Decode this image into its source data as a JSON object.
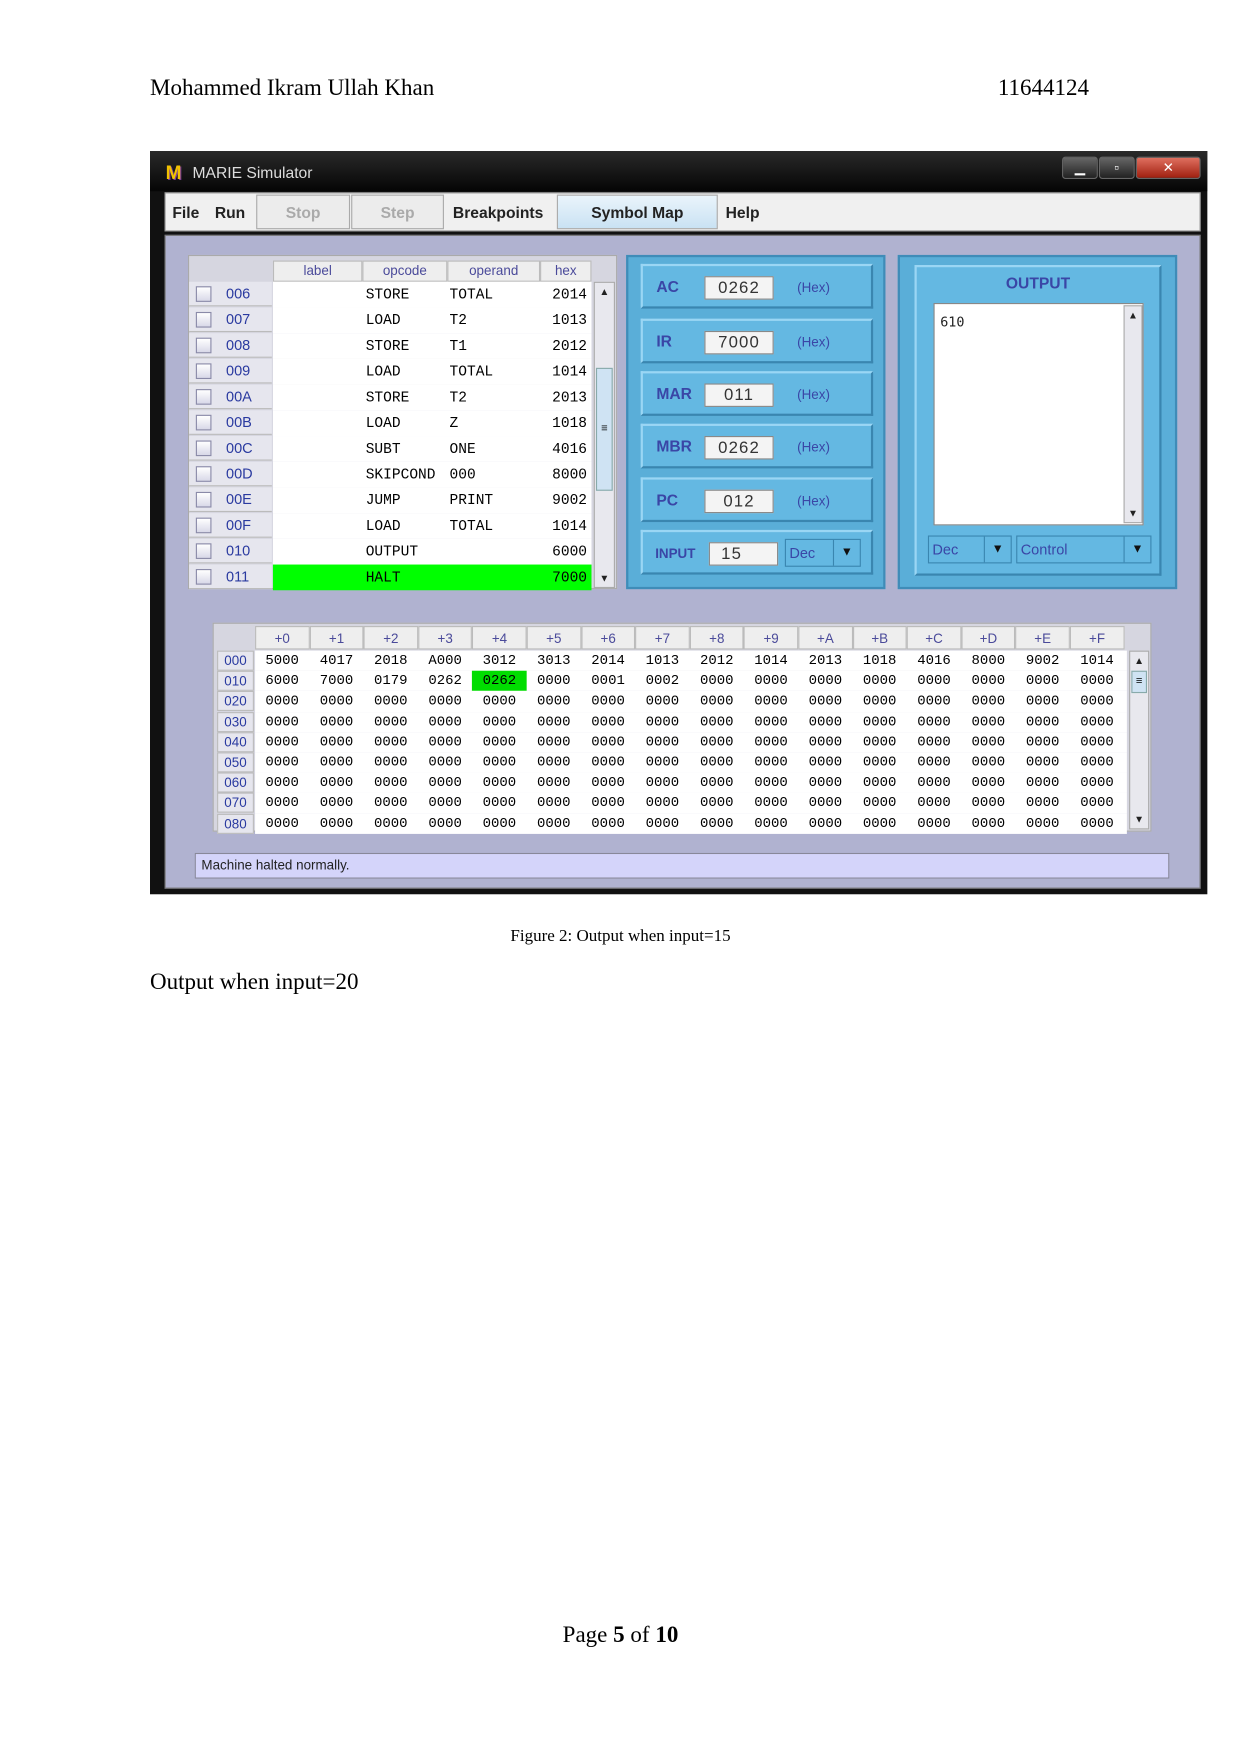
{
  "document": {
    "author": "Mohammed Ikram Ullah Khan",
    "student_id": "11644124",
    "caption": "Figure 2: Output when input=15",
    "subheading": "Output when input=20",
    "footer": {
      "prefix": "Page ",
      "current": "5",
      "middle": " of ",
      "total": "10"
    }
  },
  "window": {
    "logo": "M",
    "title": "MARIE Simulator",
    "controls": {
      "minimize": "▁",
      "maximize": "▫",
      "close": "✕"
    }
  },
  "menu": {
    "file": "File",
    "run": "Run",
    "stop": "Stop",
    "step": "Step",
    "breakpoints": "Breakpoints",
    "symbol_map": "Symbol Map",
    "help": "Help"
  },
  "program": {
    "headers": {
      "label": "label",
      "opcode": "opcode",
      "operand": "operand",
      "hex": "hex"
    },
    "highlighted_address": "011",
    "rows": [
      {
        "addr": "006",
        "label": "",
        "opcode": "STORE",
        "operand": "TOTAL",
        "hex": "2014"
      },
      {
        "addr": "007",
        "label": "",
        "opcode": "LOAD",
        "operand": "T2",
        "hex": "1013"
      },
      {
        "addr": "008",
        "label": "",
        "opcode": "STORE",
        "operand": "T1",
        "hex": "2012"
      },
      {
        "addr": "009",
        "label": "",
        "opcode": "LOAD",
        "operand": "TOTAL",
        "hex": "1014"
      },
      {
        "addr": "00A",
        "label": "",
        "opcode": "STORE",
        "operand": "T2",
        "hex": "2013"
      },
      {
        "addr": "00B",
        "label": "",
        "opcode": "LOAD",
        "operand": "Z",
        "hex": "1018"
      },
      {
        "addr": "00C",
        "label": "",
        "opcode": "SUBT",
        "operand": "ONE",
        "hex": "4016"
      },
      {
        "addr": "00D",
        "label": "",
        "opcode": "SKIPCOND",
        "operand": "000",
        "hex": "8000"
      },
      {
        "addr": "00E",
        "label": "",
        "opcode": "JUMP",
        "operand": "PRINT",
        "hex": "9002"
      },
      {
        "addr": "00F",
        "label": "",
        "opcode": "LOAD",
        "operand": "TOTAL",
        "hex": "1014"
      },
      {
        "addr": "010",
        "label": "",
        "opcode": "OUTPUT",
        "operand": "",
        "hex": "6000"
      },
      {
        "addr": "011",
        "label": "",
        "opcode": "HALT",
        "operand": "",
        "hex": "7000"
      }
    ]
  },
  "registers": [
    {
      "name": "AC",
      "value": "0262",
      "unit": "(Hex)"
    },
    {
      "name": "IR",
      "value": "7000",
      "unit": "(Hex)"
    },
    {
      "name": "MAR",
      "value": "011",
      "unit": "(Hex)"
    },
    {
      "name": "MBR",
      "value": "0262",
      "unit": "(Hex)"
    },
    {
      "name": "PC",
      "value": "012",
      "unit": "(Hex)"
    }
  ],
  "input": {
    "label": "INPUT",
    "value": "15",
    "mode": "Dec"
  },
  "output": {
    "title": "OUTPUT",
    "text": "610",
    "mode": "Dec",
    "control": "Control"
  },
  "memory": {
    "headers": [
      "+0",
      "+1",
      "+2",
      "+3",
      "+4",
      "+5",
      "+6",
      "+7",
      "+8",
      "+9",
      "+A",
      "+B",
      "+C",
      "+D",
      "+E",
      "+F"
    ],
    "highlighted_cell": {
      "row": "010",
      "col": "+4"
    },
    "rows": [
      {
        "addr": "000",
        "cells": [
          "5000",
          "4017",
          "2018",
          "A000",
          "3012",
          "3013",
          "2014",
          "1013",
          "2012",
          "1014",
          "2013",
          "1018",
          "4016",
          "8000",
          "9002",
          "1014"
        ]
      },
      {
        "addr": "010",
        "cells": [
          "6000",
          "7000",
          "0179",
          "0262",
          "0262",
          "0000",
          "0001",
          "0002",
          "0000",
          "0000",
          "0000",
          "0000",
          "0000",
          "0000",
          "0000",
          "0000"
        ]
      },
      {
        "addr": "020",
        "cells": [
          "0000",
          "0000",
          "0000",
          "0000",
          "0000",
          "0000",
          "0000",
          "0000",
          "0000",
          "0000",
          "0000",
          "0000",
          "0000",
          "0000",
          "0000",
          "0000"
        ]
      },
      {
        "addr": "030",
        "cells": [
          "0000",
          "0000",
          "0000",
          "0000",
          "0000",
          "0000",
          "0000",
          "0000",
          "0000",
          "0000",
          "0000",
          "0000",
          "0000",
          "0000",
          "0000",
          "0000"
        ]
      },
      {
        "addr": "040",
        "cells": [
          "0000",
          "0000",
          "0000",
          "0000",
          "0000",
          "0000",
          "0000",
          "0000",
          "0000",
          "0000",
          "0000",
          "0000",
          "0000",
          "0000",
          "0000",
          "0000"
        ]
      },
      {
        "addr": "050",
        "cells": [
          "0000",
          "0000",
          "0000",
          "0000",
          "0000",
          "0000",
          "0000",
          "0000",
          "0000",
          "0000",
          "0000",
          "0000",
          "0000",
          "0000",
          "0000",
          "0000"
        ]
      },
      {
        "addr": "060",
        "cells": [
          "0000",
          "0000",
          "0000",
          "0000",
          "0000",
          "0000",
          "0000",
          "0000",
          "0000",
          "0000",
          "0000",
          "0000",
          "0000",
          "0000",
          "0000",
          "0000"
        ]
      },
      {
        "addr": "070",
        "cells": [
          "0000",
          "0000",
          "0000",
          "0000",
          "0000",
          "0000",
          "0000",
          "0000",
          "0000",
          "0000",
          "0000",
          "0000",
          "0000",
          "0000",
          "0000",
          "0000"
        ]
      },
      {
        "addr": "080",
        "cells": [
          "0000",
          "0000",
          "0000",
          "0000",
          "0000",
          "0000",
          "0000",
          "0000",
          "0000",
          "0000",
          "0000",
          "0000",
          "0000",
          "0000",
          "0000",
          "0000"
        ]
      }
    ]
  },
  "status": "Machine halted normally.",
  "colors": {
    "highlight": "#00ff00",
    "panel_blue": "#5aaed8",
    "workspace": "#b0b2d0",
    "label_blue": "#3a46a6"
  },
  "icons": {
    "scroll_up": "▲",
    "scroll_down": "▼",
    "dropdown": "▼",
    "scroll_grip": "≡"
  }
}
